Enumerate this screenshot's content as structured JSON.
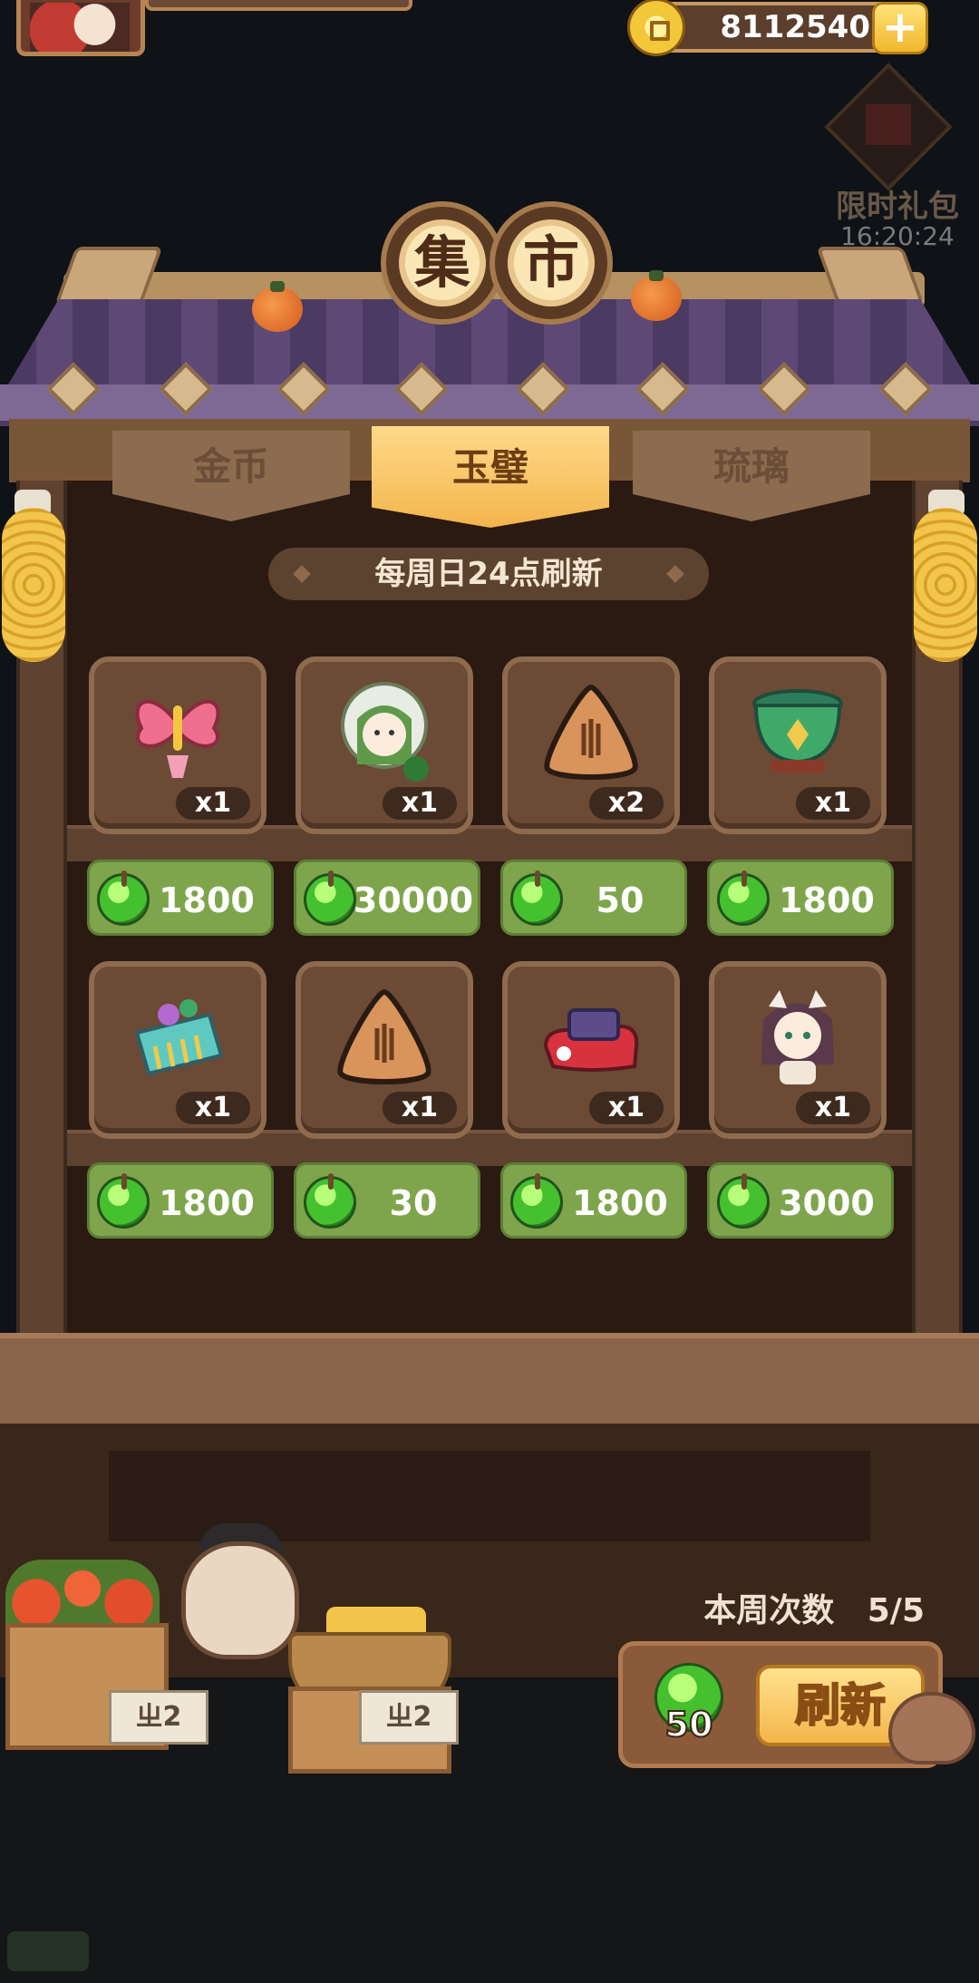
{
  "header": {
    "coins": "8112540",
    "plus_label": "+"
  },
  "gift": {
    "label": "限时礼包",
    "timer": "16:20:24"
  },
  "title": [
    "集",
    "市"
  ],
  "tabs": [
    {
      "label": "金币",
      "active": false
    },
    {
      "label": "玉璧",
      "active": true
    },
    {
      "label": "琉璃",
      "active": false
    }
  ],
  "notice": "每周日24点刷新",
  "items": [
    {
      "icon": "butterfly-ornament-icon",
      "qty": "x1",
      "price": "1800"
    },
    {
      "icon": "green-hood-character-icon",
      "qty": "x1",
      "price": "30000"
    },
    {
      "icon": "rice-cake-triangle-icon",
      "qty": "x2",
      "price": "50"
    },
    {
      "icon": "jade-pot-icon",
      "qty": "x1",
      "price": "1800"
    },
    {
      "icon": "ornate-comb-icon",
      "qty": "x1",
      "price": "1800"
    },
    {
      "icon": "rice-cake-triangle-icon",
      "qty": "x1",
      "price": "30"
    },
    {
      "icon": "red-ink-stone-icon",
      "qty": "x1",
      "price": "1800"
    },
    {
      "icon": "cat-ear-girl-character-icon",
      "qty": "x1",
      "price": "3000"
    }
  ],
  "refresh": {
    "week_label": "本周次数",
    "week_count": "5/5",
    "cost": "50",
    "button_label": "刷新"
  },
  "stall": {
    "sign_left": "ㄓ2",
    "sign_right": "ㄓ2"
  },
  "colors": {
    "price_bg": "#7ea54b",
    "active_tab": "#f3b54c",
    "panel_bg": "#2a1a12"
  }
}
